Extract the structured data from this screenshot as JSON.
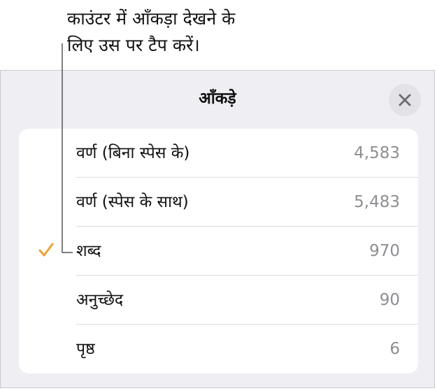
{
  "callout": {
    "line1": "काउंटर में आँकड़ा देखने के",
    "line2": "लिए उस पर टैप करें।"
  },
  "popover": {
    "title": "आँकड़े",
    "close_icon": "close-icon"
  },
  "stats": [
    {
      "label": "वर्ण (बिना स्पेस के)",
      "value": "4,583",
      "selected": false
    },
    {
      "label": "वर्ण (स्पेस के साथ)",
      "value": "5,483",
      "selected": false
    },
    {
      "label": "शब्द",
      "value": "970",
      "selected": true
    },
    {
      "label": "अनुच्छेद",
      "value": "90",
      "selected": false
    },
    {
      "label": "पृष्ठ",
      "value": "6",
      "selected": false
    }
  ],
  "colors": {
    "checkmark": "#f0a22e",
    "popover_background": "#efeff3",
    "value_text": "#8e8e93"
  }
}
